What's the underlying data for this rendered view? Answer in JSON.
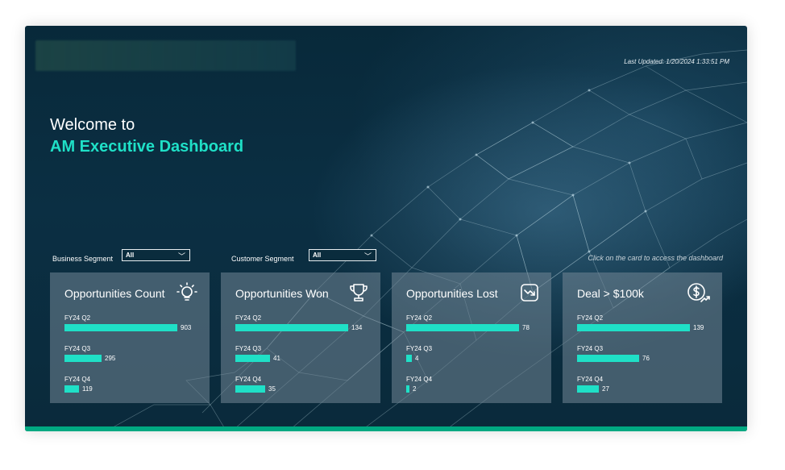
{
  "header": {
    "last_updated": "Last Updated: 1/20/2024 1:33:51 PM",
    "welcome": "Welcome to",
    "title": "AM Executive Dashboard"
  },
  "filters": {
    "business_segment": {
      "label": "Business Segment",
      "value": "All"
    },
    "customer_segment": {
      "label": "Customer Segment",
      "value": "All"
    }
  },
  "hint": "Click on the card to access the dashboard",
  "colors": {
    "accent": "#1fe0c7",
    "footer": "#01a982"
  },
  "cards": [
    {
      "title": "Opportunities Count",
      "icon": "lightbulb-icon",
      "metrics": [
        {
          "label": "FY24 Q2",
          "value": 903
        },
        {
          "label": "FY24 Q3",
          "value": 295
        },
        {
          "label": "FY24 Q4",
          "value": 119
        }
      ]
    },
    {
      "title": "Opportunities Won",
      "icon": "trophy-icon",
      "metrics": [
        {
          "label": "FY24 Q2",
          "value": 134
        },
        {
          "label": "FY24 Q3",
          "value": 41
        },
        {
          "label": "FY24 Q4",
          "value": 35
        }
      ]
    },
    {
      "title": "Opportunities Lost",
      "icon": "trend-down-icon",
      "metrics": [
        {
          "label": "FY24 Q2",
          "value": 78
        },
        {
          "label": "FY24 Q3",
          "value": 4
        },
        {
          "label": "FY24 Q4",
          "value": 2
        }
      ]
    },
    {
      "title": "Deal > $100k",
      "icon": "dollar-growth-icon",
      "metrics": [
        {
          "label": "FY24 Q2",
          "value": 139
        },
        {
          "label": "FY24 Q3",
          "value": 76
        },
        {
          "label": "FY24 Q4",
          "value": 27
        }
      ]
    }
  ]
}
